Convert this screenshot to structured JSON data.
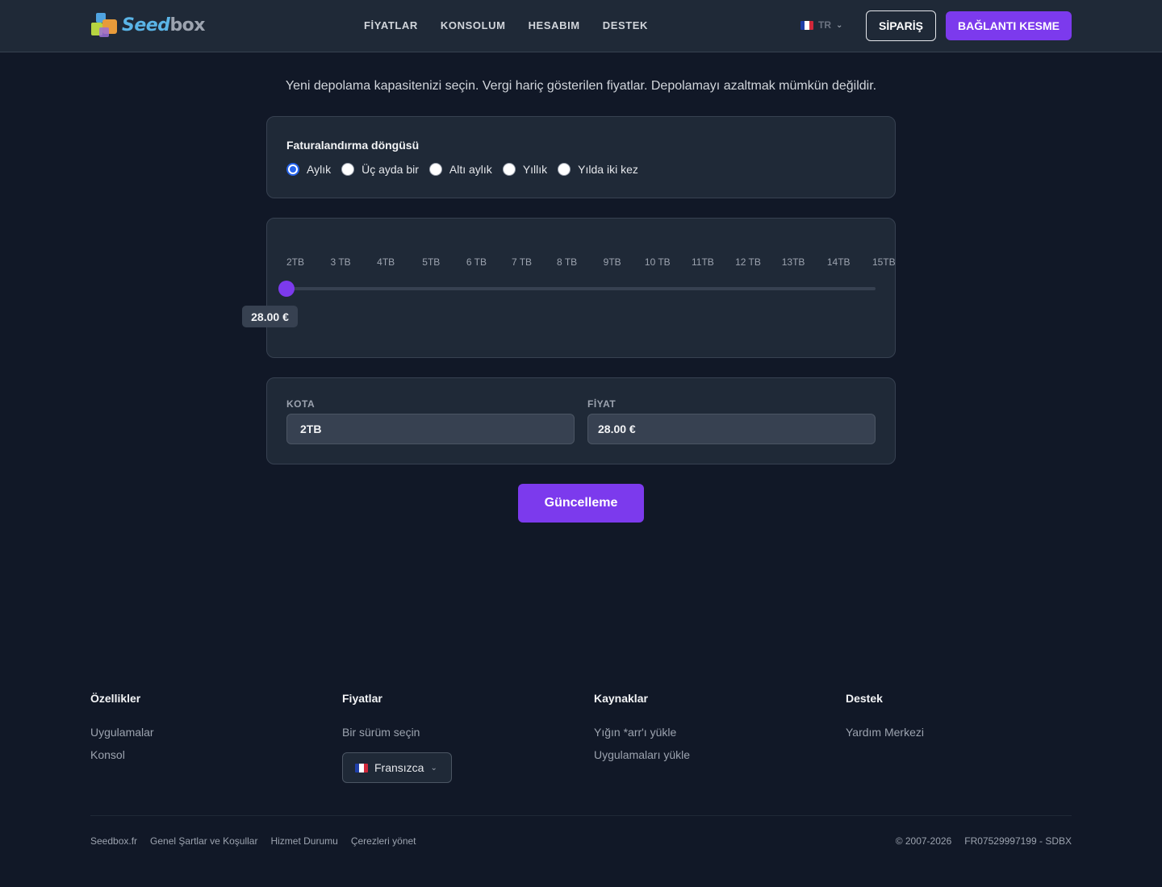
{
  "header": {
    "logo": {
      "part1": "Seed",
      "part2": "box"
    },
    "nav": [
      "FİYATLAR",
      "KONSOLUM",
      "HESABIM",
      "DESTEK"
    ],
    "language": "TR",
    "order_label": "SİPARİŞ",
    "logout_label": "BAĞLANTI KESME"
  },
  "intro": "Yeni depolama kapasitenizi seçin. Vergi hariç gösterilen fiyatlar. Depolamayı azaltmak mümkün değildir.",
  "billing": {
    "title": "Faturalandırma döngüsü",
    "options": [
      "Aylık",
      "Üç ayda bir",
      "Altı aylık",
      "Yıllık",
      "Yılda iki kez"
    ],
    "selected": "Aylık"
  },
  "slider": {
    "ticks": [
      "2TB",
      "3 TB",
      "4TB",
      "5TB",
      "6 TB",
      "7 TB",
      "8 TB",
      "9TB",
      "10 TB",
      "11TB",
      "12 TB",
      "13TB",
      "14TB",
      "15TB"
    ],
    "selected_index": 0,
    "price_tip": "28.00 €"
  },
  "fields": {
    "quota_label": "KOTA",
    "quota_value": "2TB",
    "price_label": "FİYAT",
    "price_value": "28.00 €"
  },
  "update_label": "Güncelleme",
  "footer": {
    "features": {
      "title": "Özellikler",
      "links": [
        "Uygulamalar",
        "Konsol"
      ]
    },
    "pricing": {
      "title": "Fiyatlar",
      "links": [
        "Bir sürüm seçin"
      ],
      "language_select": "Fransızca"
    },
    "resources": {
      "title": "Kaynaklar",
      "links": [
        "Yığın *arr'ı yükle",
        "Uygulamaları yükle"
      ]
    },
    "support": {
      "title": "Destek",
      "links": [
        "Yardım Merkezi"
      ]
    },
    "bottom_links": [
      "Seedbox.fr",
      "Genel Şartlar ve Koşullar",
      "Hizmet Durumu",
      "Çerezleri yönet"
    ],
    "copyright": "© 2007-2026",
    "company_id": "FR07529997199 - SDBX"
  },
  "colors": {
    "accent": "#7c3aed",
    "background": "#111827",
    "card": "#1f2937"
  }
}
